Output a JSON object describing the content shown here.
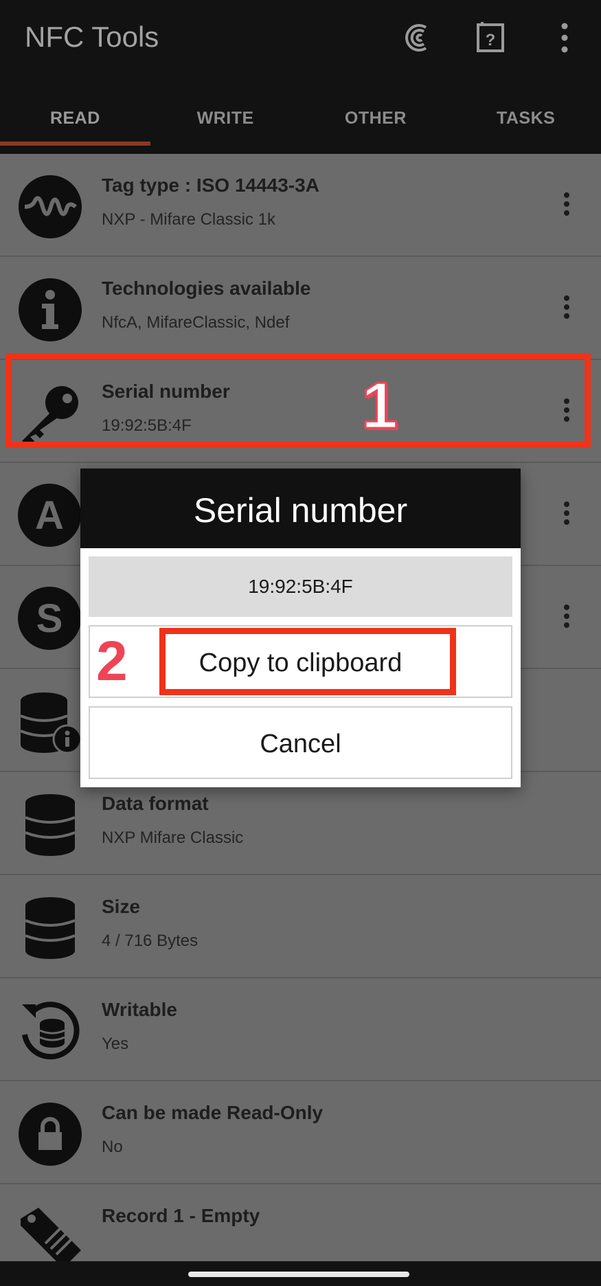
{
  "app": {
    "title": "NFC Tools"
  },
  "tabs": [
    "READ",
    "WRITE",
    "OTHER",
    "TASKS"
  ],
  "rows": [
    {
      "title": "Tag type : ISO 14443-3A",
      "sub": "NXP - Mifare Classic 1k",
      "icon": "waveform-icon",
      "menu": true
    },
    {
      "title": "Technologies available",
      "sub": "NfcA, MifareClassic, Ndef",
      "icon": "info-icon",
      "menu": true
    },
    {
      "title": "Serial number",
      "sub": "19:92:5B:4F",
      "icon": "key-icon",
      "menu": true
    },
    {
      "title": "",
      "sub": "",
      "icon": "letter-a-icon",
      "menu": true,
      "glyph": "A"
    },
    {
      "title": "",
      "sub": "",
      "icon": "letter-s-icon",
      "menu": true,
      "glyph": "S"
    },
    {
      "title": "",
      "sub": "",
      "icon": "database-info-icon",
      "menu": false
    },
    {
      "title": "Data format",
      "sub": "NXP Mifare Classic",
      "icon": "database-icon",
      "menu": false
    },
    {
      "title": "Size",
      "sub": "4 / 716 Bytes",
      "icon": "database-icon",
      "menu": false
    },
    {
      "title": "Writable",
      "sub": "Yes",
      "icon": "database-refresh-icon",
      "menu": false
    },
    {
      "title": "Can be made Read-Only",
      "sub": "No",
      "icon": "lock-icon",
      "menu": false
    },
    {
      "title": "Record 1 - Empty",
      "sub": "",
      "icon": "tag-icon",
      "menu": false
    }
  ],
  "dialog": {
    "title": "Serial number",
    "value": "19:92:5B:4F",
    "copy_label": "Copy to clipboard",
    "cancel_label": "Cancel"
  },
  "annotations": {
    "step1": "1",
    "step2": "2",
    "highlight_color": "#f03318"
  },
  "colors": {
    "appbar": "#121212",
    "tab_indicator": "#8a3a22",
    "scrim": "#6b6b6b"
  }
}
